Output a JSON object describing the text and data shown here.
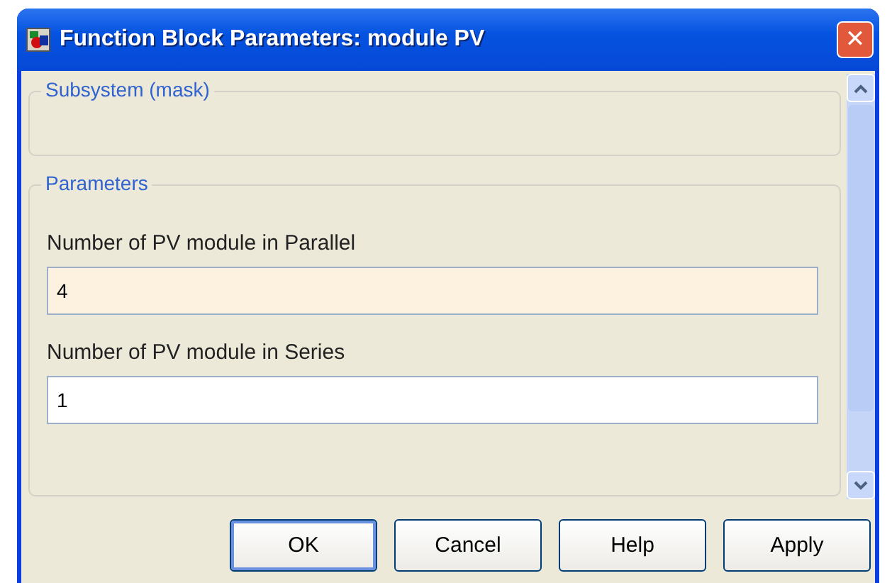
{
  "window": {
    "title": "Function Block Parameters: module PV",
    "close": "✕"
  },
  "sections": [
    {
      "title": "Subsystem (mask)"
    },
    {
      "title": "Parameters",
      "fields": [
        {
          "label": "Number of PV module in Parallel",
          "value": "4",
          "focused": true
        },
        {
          "label": "Number of PV module in Series",
          "value": "1",
          "focused": false
        }
      ]
    }
  ],
  "buttons": [
    {
      "label": "OK",
      "default": true
    },
    {
      "label": "Cancel",
      "default": false
    },
    {
      "label": "Help",
      "default": false
    },
    {
      "label": "Apply",
      "default": false
    }
  ]
}
